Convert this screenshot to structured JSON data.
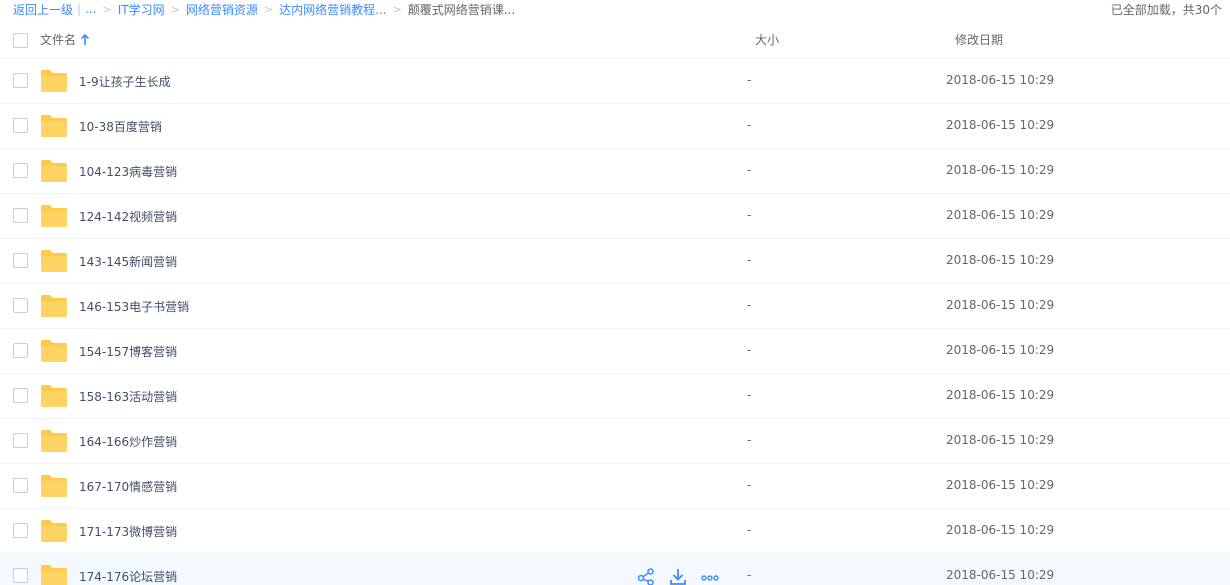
{
  "breadcrumb": {
    "back_label": "返回上一级",
    "ellipsis": "...",
    "items": [
      "IT学习网",
      "网络营销资源",
      "达内网络营销教程..."
    ],
    "current": "颠覆式网络营销课..."
  },
  "load_status": "已全部加载，共30个",
  "columns": {
    "name": "文件名",
    "size": "大小",
    "date": "修改日期"
  },
  "files": [
    {
      "name": "1-9让孩子生长成",
      "size": "-",
      "date": "2018-06-15 10:29"
    },
    {
      "name": "10-38百度营销",
      "size": "-",
      "date": "2018-06-15 10:29"
    },
    {
      "name": "104-123病毒营销",
      "size": "-",
      "date": "2018-06-15 10:29"
    },
    {
      "name": "124-142视频营销",
      "size": "-",
      "date": "2018-06-15 10:29"
    },
    {
      "name": "143-145新闻营销",
      "size": "-",
      "date": "2018-06-15 10:29"
    },
    {
      "name": "146-153电子书营销",
      "size": "-",
      "date": "2018-06-15 10:29"
    },
    {
      "name": "154-157博客营销",
      "size": "-",
      "date": "2018-06-15 10:29"
    },
    {
      "name": "158-163活动营销",
      "size": "-",
      "date": "2018-06-15 10:29"
    },
    {
      "name": "164-166炒作营销",
      "size": "-",
      "date": "2018-06-15 10:29"
    },
    {
      "name": "167-170情感营销",
      "size": "-",
      "date": "2018-06-15 10:29"
    },
    {
      "name": "171-173微博营销",
      "size": "-",
      "date": "2018-06-15 10:29"
    },
    {
      "name": "174-176论坛营销",
      "size": "-",
      "date": "2018-06-15 10:29"
    }
  ],
  "hovered_row_index": 11,
  "row_action_icons": [
    "share-icon",
    "download-icon",
    "more-icon"
  ],
  "colors": {
    "link": "#3b8cff",
    "folder": "#ffd464",
    "hover_row": "#f4f9ff"
  }
}
